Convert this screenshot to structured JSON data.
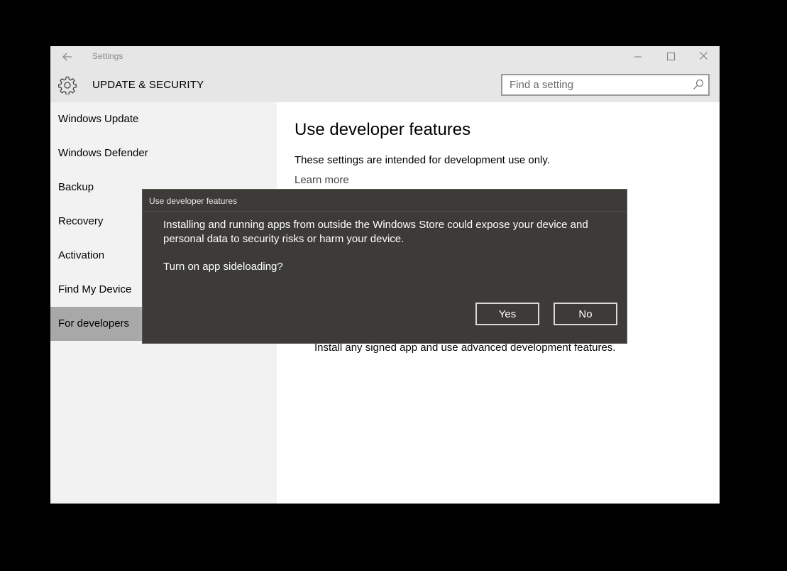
{
  "window": {
    "title": "Settings",
    "controls": {
      "minimize": "—",
      "maximize": "☐",
      "close": "✕"
    }
  },
  "header": {
    "title": "UPDATE & SECURITY",
    "icon": "gear-icon"
  },
  "search": {
    "placeholder": "Find a setting",
    "value": ""
  },
  "sidebar": {
    "items": [
      {
        "label": "Windows Update"
      },
      {
        "label": "Windows Defender"
      },
      {
        "label": "Backup"
      },
      {
        "label": "Recovery"
      },
      {
        "label": "Activation"
      },
      {
        "label": "Find My Device"
      },
      {
        "label": "For developers",
        "selected": true
      }
    ]
  },
  "main": {
    "title": "Use developer features",
    "description": "These settings are intended for development use only.",
    "learn_more": "Learn more",
    "developer_mode_description": "Install any signed app and use advanced development features."
  },
  "dialog": {
    "title": "Use developer features",
    "message": "Installing and running apps from outside the Windows Store could expose your device and personal data to security risks or harm your device.",
    "question": "Turn on app sideloading?",
    "yes_label": "Yes",
    "no_label": "No"
  },
  "colors": {
    "dialog_background": "#3c3b38",
    "selected_nav": "#a8a8a8",
    "sidebar_background": "#f2f2f2",
    "header_background": "#e6e6e6"
  }
}
